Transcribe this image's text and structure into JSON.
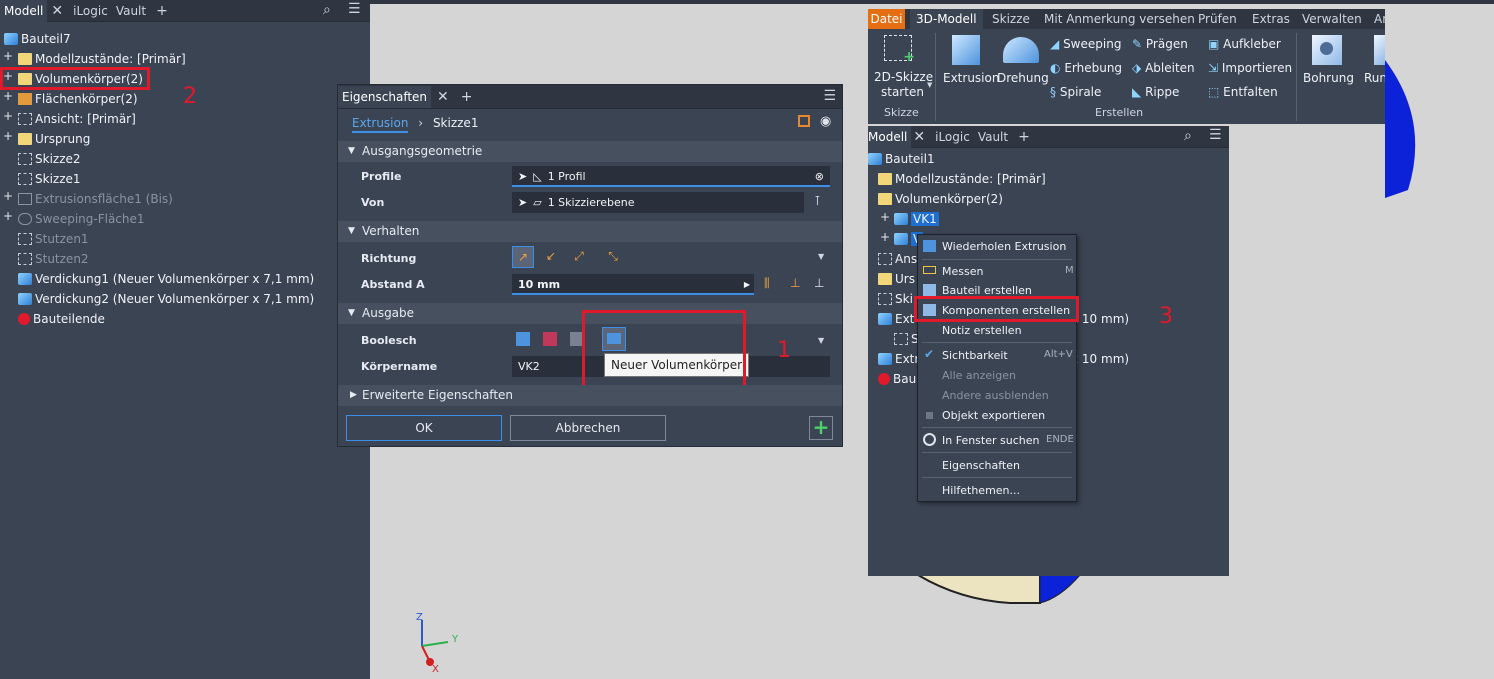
{
  "left_browser": {
    "tabs": [
      "Modell",
      "iLogic",
      "Vault"
    ],
    "tree": [
      {
        "label": "Bauteil7",
        "icon": "part-icon",
        "grey": false
      },
      {
        "label": "Modellzustände: [Primär]",
        "icon": "folder-icon",
        "grey": false
      },
      {
        "label": "Volumenkörper(2)",
        "icon": "folder-icon",
        "grey": false
      },
      {
        "label": "Flächenkörper(2)",
        "icon": "surface-folder-icon",
        "grey": false
      },
      {
        "label": "Ansicht: [Primär]",
        "icon": "view-icon",
        "grey": false
      },
      {
        "label": "Ursprung",
        "icon": "folder-icon",
        "grey": false
      },
      {
        "label": "Skizze2",
        "icon": "sketch-icon",
        "grey": false
      },
      {
        "label": "Skizze1",
        "icon": "sketch-icon",
        "grey": false
      },
      {
        "label": "Extrusionsfläche1 (Bis)",
        "icon": "extrude-surface-icon",
        "grey": true
      },
      {
        "label": "Sweeping-Fläche1",
        "icon": "sweep-surface-icon",
        "grey": true
      },
      {
        "label": "Stutzen1",
        "icon": "boss-icon",
        "grey": true
      },
      {
        "label": "Stutzen2",
        "icon": "boss-icon",
        "grey": true
      },
      {
        "label": "Verdickung1 (Neuer Volumenkörper x 7,1 mm)",
        "icon": "thicken-icon",
        "grey": false
      },
      {
        "label": "Verdickung2 (Neuer Volumenkörper x 7,1 mm)",
        "icon": "thicken-icon",
        "grey": false
      },
      {
        "label": "Bauteilende",
        "icon": "end-of-part-icon",
        "grey": false
      }
    ]
  },
  "annotations": {
    "one": "1",
    "two": "2",
    "three": "3"
  },
  "dialog": {
    "title": "Eigenschaften",
    "breadcrumb_link": "Extrusion",
    "breadcrumb_sep": "›",
    "breadcrumb_current": "Skizze1",
    "section_input": "Ausgangsgeometrie",
    "profile_label": "Profile",
    "profile_value": "1 Profil",
    "from_label": "Von",
    "from_value": "1 Skizzierebene",
    "section_behavior": "Verhalten",
    "direction_label": "Richtung",
    "distance_label": "Abstand A",
    "distance_value": "10 mm",
    "section_output": "Ausgabe",
    "boolean_label": "Boolesch",
    "bodyname_label": "Körpername",
    "bodyname_value": "VK2",
    "tooltip": "Neuer Volumenkörper",
    "section_advanced": "Erweiterte Eigenschaften",
    "ok": "OK",
    "cancel": "Abbrechen"
  },
  "ribbon": {
    "file_tab": "Datei",
    "tabs": [
      "3D-Modell",
      "Skizze",
      "Mit Anmerkung versehen",
      "Prüfen",
      "Extras",
      "Verwalten",
      "An"
    ],
    "sketch_btn_line1": "2D-Skizze",
    "sketch_btn_line2": "starten",
    "group_sketch": "Skizze",
    "extrusion": "Extrusion",
    "revolve": "Drehung",
    "sweep": "Sweeping",
    "emboss": "Prägen",
    "decal": "Aufkleber",
    "loft": "Erhebung",
    "derive": "Ableiten",
    "import": "Importieren",
    "coil": "Spirale",
    "rib": "Rippe",
    "unwrap": "Entfalten",
    "group_create": "Erstellen",
    "hole": "Bohrung",
    "fillet_cut": "Run"
  },
  "right_browser": {
    "tabs": [
      "Modell",
      "iLogic",
      "Vault"
    ],
    "tree": [
      "Bauteil1",
      "Modellzustände: [Primär]",
      "Volumenkörper(2)",
      "VK1",
      "V",
      "Ans",
      "Urs",
      "Ski",
      "Ext",
      "S",
      "Extr",
      "Bau"
    ],
    "tail1": "x 10 mm)",
    "tail2": "x 10 mm)"
  },
  "context_menu": {
    "items": [
      {
        "label": "Wiederholen Extrusion",
        "shortcut": "",
        "disabled": false
      },
      {
        "label": "Messen",
        "shortcut": "M",
        "disabled": false
      },
      {
        "label": "Bauteil erstellen",
        "shortcut": "",
        "disabled": false
      },
      {
        "label": "Komponenten erstellen",
        "shortcut": "",
        "disabled": false
      },
      {
        "label": "Notiz erstellen",
        "shortcut": "",
        "disabled": false
      },
      {
        "label": "Sichtbarkeit",
        "shortcut": "Alt+V",
        "disabled": false
      },
      {
        "label": "Alle anzeigen",
        "shortcut": "",
        "disabled": true
      },
      {
        "label": "Andere ausblenden",
        "shortcut": "",
        "disabled": true
      },
      {
        "label": "Objekt exportieren",
        "shortcut": "",
        "disabled": false
      },
      {
        "label": "In Fenster suchen",
        "shortcut": "ENDE",
        "disabled": false
      },
      {
        "label": "Eigenschaften",
        "shortcut": "",
        "disabled": false
      },
      {
        "label": "Hilfethemen...",
        "shortcut": "",
        "disabled": false
      }
    ]
  },
  "axes": {
    "x": "X",
    "y": "Y",
    "z": "Z"
  },
  "colors": {
    "highlight_red": "#e0192b",
    "panel": "#3b4453",
    "accent_blue": "#3d8ee6"
  }
}
